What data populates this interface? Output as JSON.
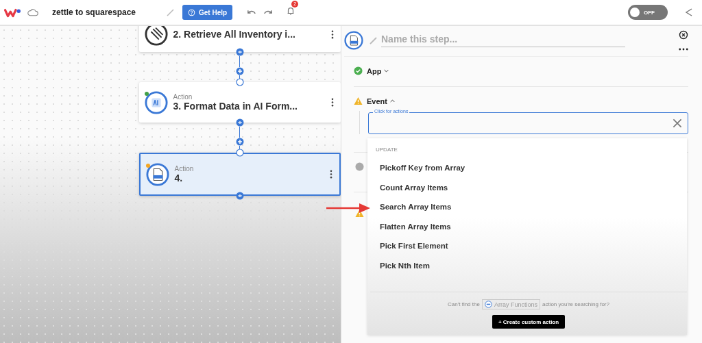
{
  "topbar": {
    "title": "zettle to squarespace",
    "help_button": "Get Help",
    "notifications": "2",
    "toggle": {
      "on": false,
      "label": "OFF"
    }
  },
  "steps": [
    {
      "kind": "retrieve",
      "title": "2. Retrieve All Inventory i...",
      "selected": false
    },
    {
      "kind": "ai",
      "label": "Action",
      "title": "3. Format Data in AI Form...",
      "selected": false,
      "color": "#43a047"
    },
    {
      "kind": "csv",
      "label": "Action",
      "title": "4.",
      "selected": true,
      "color": "#f5a623"
    }
  ],
  "panel": {
    "name_field": {
      "placeholder": "Name this step..."
    },
    "sections": [
      {
        "title": "App",
        "kind": "check",
        "expanded": false
      },
      {
        "title": "Event",
        "kind": "warning",
        "expanded": true
      }
    ],
    "event_field": {
      "label": "Click for actions"
    },
    "dropdown": {
      "group": "UPDATE",
      "items": [
        {
          "label": "Pickoff Key from Array"
        },
        {
          "label": "Count Array Items"
        },
        {
          "label": "Search Array Items"
        },
        {
          "label": "Flatten Array Items"
        },
        {
          "label": "Pick First Element"
        },
        {
          "label": "Pick Nth Item"
        }
      ],
      "hint_before": "Can't find the",
      "hint_chip": "Array Functions",
      "hint_after": "action you're searching for?",
      "create_button": "+ Create custom action"
    }
  }
}
